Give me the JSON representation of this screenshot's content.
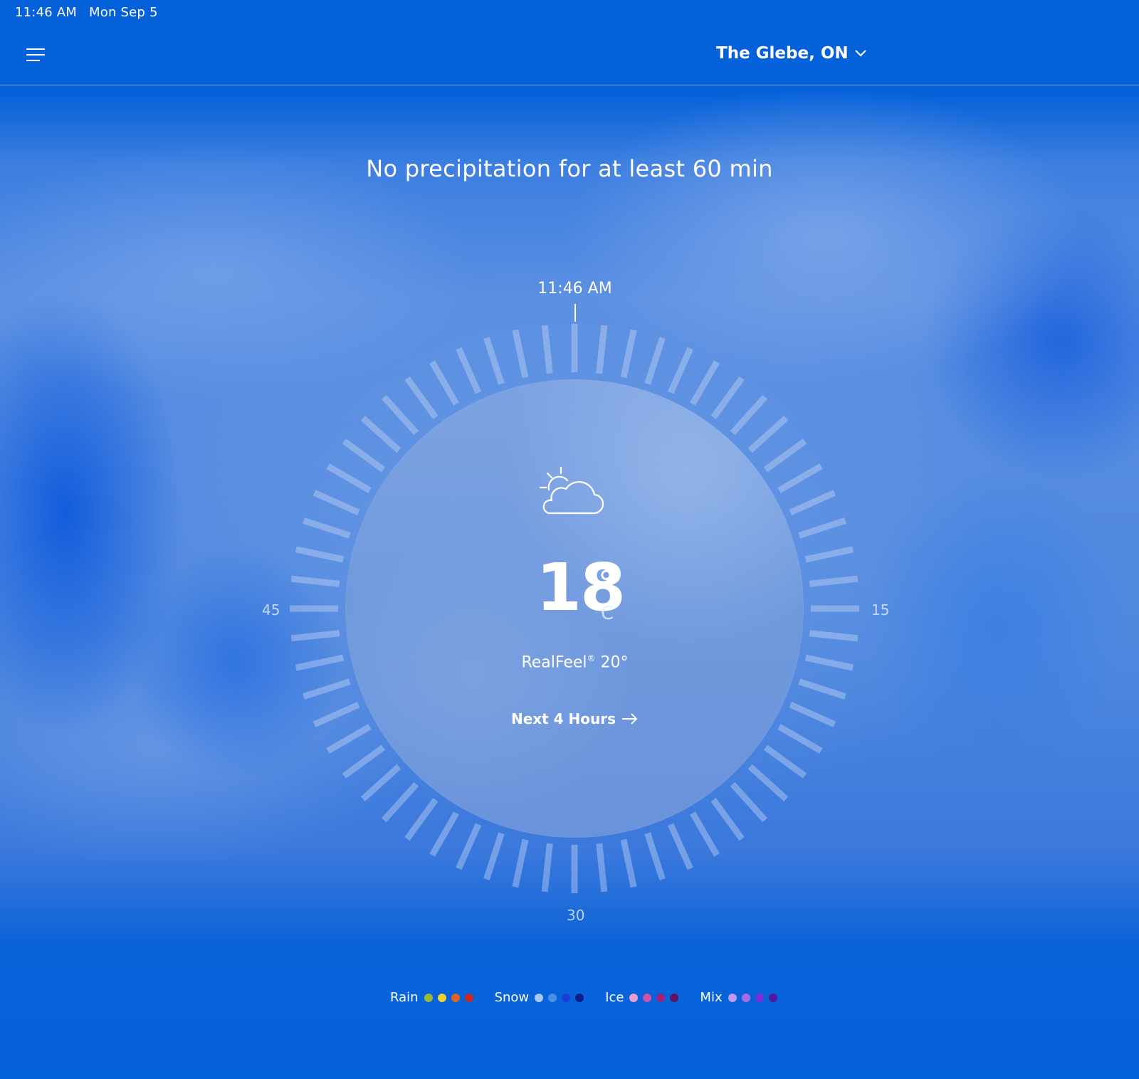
{
  "status_bar": {
    "time": "11:46 AM",
    "date": "Mon Sep 5"
  },
  "header": {
    "menu_icon": "hamburger-menu-icon",
    "location": "The Glebe, ON",
    "location_chevron_icon": "chevron-down-icon"
  },
  "minutecast": {
    "summary": "No precipitation for at least 60 min",
    "current_time": "11:46 AM",
    "minute_marks": {
      "right": "15",
      "bottom": "30",
      "left": "45"
    }
  },
  "current": {
    "condition_icon": "partly-sunny-icon",
    "temperature": "18",
    "degree_symbol": "°",
    "unit": "C",
    "realfeel_label": "RealFeel",
    "realfeel_mark": "®",
    "realfeel_value": "20°",
    "next_hours_label": "Next 4 Hours",
    "next_hours_icon": "arrow-right-icon"
  },
  "legend": [
    {
      "label": "Rain",
      "colors": [
        "#9bb83c",
        "#f0d038",
        "#e0642a",
        "#c82a20"
      ]
    },
    {
      "label": "Snow",
      "colors": [
        "#a7c8f2",
        "#4a90e2",
        "#1c3ed6",
        "#0c1c8a"
      ]
    },
    {
      "label": "Ice",
      "colors": [
        "#e8a0d2",
        "#cc52a8",
        "#a0207e",
        "#5e1460"
      ]
    },
    {
      "label": "Mix",
      "colors": [
        "#c09cf0",
        "#a86ae6",
        "#7e2ed6",
        "#4e18a0"
      ]
    }
  ]
}
